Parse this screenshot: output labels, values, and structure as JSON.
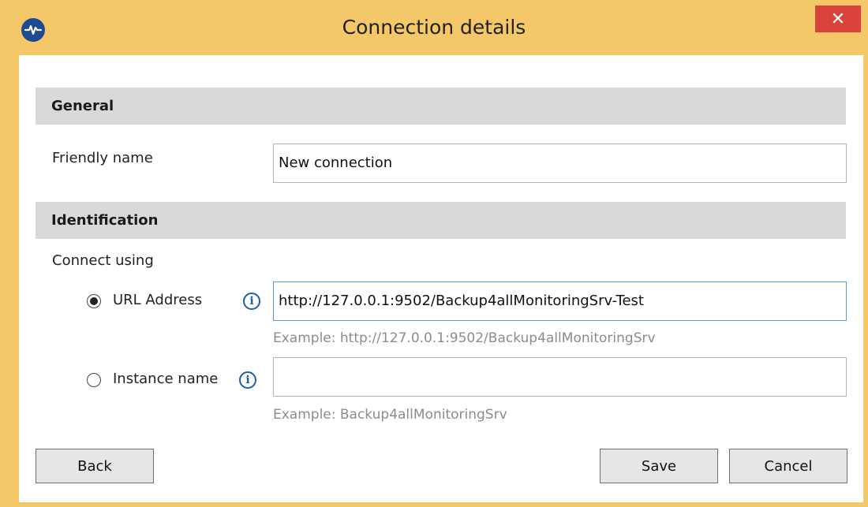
{
  "window": {
    "title": "Connection details",
    "close_symbol": "✕",
    "icon": "pulse-logo-icon"
  },
  "general": {
    "header": "General",
    "friendly_name_label": "Friendly name",
    "friendly_name_value": "New connection"
  },
  "identification": {
    "header": "Identification",
    "connect_using_label": "Connect using",
    "url_option": {
      "label": "URL Address",
      "selected": true,
      "value": "http://127.0.0.1:9502/Backup4allMonitoringSrv-Test",
      "example": "Example: http://127.0.0.1:9502/Backup4allMonitoringSrv",
      "info_icon": "info-icon"
    },
    "instance_option": {
      "label": "Instance name",
      "selected": false,
      "value": "",
      "example": "Example: Backup4allMonitoringSrv",
      "info_icon": "info-icon"
    }
  },
  "buttons": {
    "back": "Back",
    "save": "Save",
    "cancel": "Cancel"
  }
}
